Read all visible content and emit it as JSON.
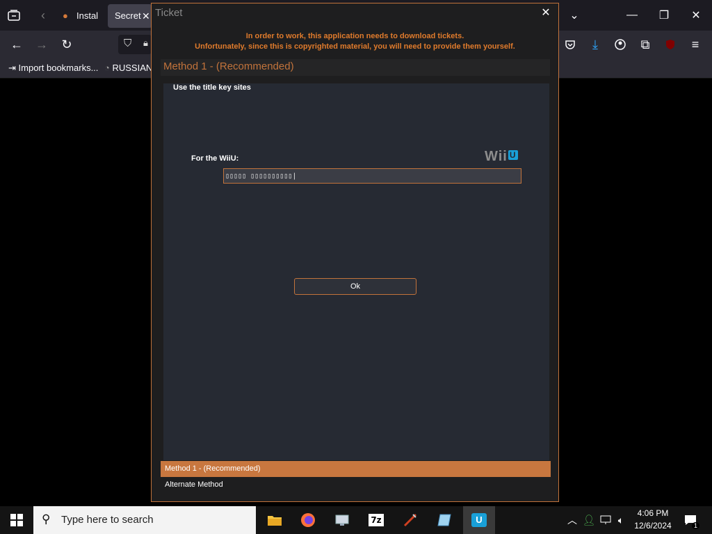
{
  "browser": {
    "tabs": [
      {
        "label": "Instal"
      },
      {
        "label": "Secret"
      }
    ],
    "bookmarks": [
      {
        "label": "Import bookmarks..."
      },
      {
        "label": "RUSSIAN"
      }
    ]
  },
  "dialog": {
    "title": "Ticket",
    "notice_line1": "In order to work, this application needs to download tickets.",
    "notice_line2": "Unfortunately, since this is copyrighted material, you will need to provide them yourself.",
    "method_header": "Method 1 - (Recommended)",
    "panel_heading": "Use the title key sites",
    "wiiu_label": "For the WiiU:",
    "wiiu_logo_text": "Wii",
    "wiiu_logo_badge": "U",
    "key_input_value": "▯▯▯▯▯ ▯▯▯▯▯▯▯▯▯▯|",
    "ok_label": "Ok",
    "method_tabs": [
      "Method 1 - (Recommended)",
      "Alternate Method"
    ],
    "accent_color": "#c2733b"
  },
  "taskbar": {
    "search_placeholder": "Type here to search",
    "time": "4:06 PM",
    "date": "12/6/2024",
    "notification_count": "1"
  }
}
